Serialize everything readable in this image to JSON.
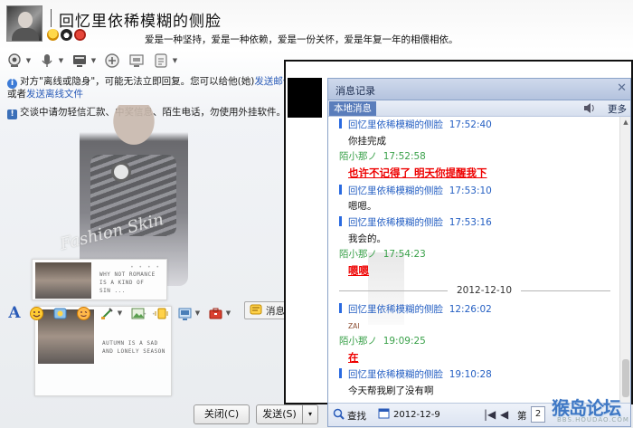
{
  "header": {
    "contact_name": "回忆里依稀模糊的侧脸",
    "signature": "爱是一种坚持，爱是一种依赖，爱是一份关怀，爱是年复一年的相偎相依。"
  },
  "tips": {
    "offline_prefix": "对方\"离线或隐身\"，可能无法立即回复。您可以给他(她)",
    "offline_link_1": "发送邮件",
    "offline_mid": "或者",
    "offline_link_2": "发送离线文件",
    "safety": "交谈中请勿轻信汇款、中奖信息、陌生电话，勿使用外挂软件。"
  },
  "skin": {
    "fashion_text": "Fashion Skin",
    "card_1_caption": "WHY NOT ROMANCE\nIS A KIND OF\nSIN ...",
    "card_2_caption": "AUTUMN IS A SAD\nAND LONELY SEASON"
  },
  "format_toolbar": {
    "font_glyph": "A",
    "chat_log_label": "消息记录"
  },
  "buttons": {
    "close": "关闭(C)",
    "send": "发送(S)",
    "send_options": "▾"
  },
  "history": {
    "title": "消息记录",
    "close_glyph": "✕",
    "local_tab": "本地消息",
    "more": "更多",
    "date_divider": "2012-12-10",
    "messages": [
      {
        "sender": "回忆里依稀模糊的侧脸",
        "time": "17:52:40",
        "text": "你挂完成"
      },
      {
        "sender": "陌小那ノ",
        "time": "17:52:58",
        "text": "也许不记得了 明天你提醒我下"
      },
      {
        "sender": "回忆里依稀模糊的侧脸",
        "time": "17:53:10",
        "text": "嗯嗯。"
      },
      {
        "sender": "回忆里依稀模糊的侧脸",
        "time": "17:53:16",
        "text": "我会的。"
      },
      {
        "sender": "陌小那ノ",
        "time": "17:54:23",
        "text": "嗯嗯"
      },
      {
        "sender": "回忆里依稀模糊的侧脸",
        "time": "12:26:02",
        "text": "ZAI"
      },
      {
        "sender": "陌小那ノ",
        "time": "19:09:25",
        "text": "在"
      },
      {
        "sender": "回忆里依稀模糊的侧脸",
        "time": "19:10:28",
        "text": "今天帮我刷了没有啊"
      }
    ],
    "footer": {
      "find_label": "查找",
      "date_value": "2012-12-9",
      "first_glyph": "|◀",
      "prev_glyph": "◀",
      "page_label": "第",
      "page_value": "2"
    }
  },
  "watermark": {
    "title": "猴岛论坛",
    "subtitle": "BBS.HOUDAO.COM"
  },
  "colors": {
    "self_name": "#2660c3",
    "other_name": "#3aa14a",
    "alert_text": "#e00000",
    "panel_border": "#8aa2c8"
  },
  "icons": [
    "video-call-icon",
    "voice-call-icon",
    "screen-share-icon",
    "add-member-icon",
    "remote-assist-icon",
    "app-icon",
    "emoji-icon",
    "face-magic-icon",
    "wink-icon",
    "screenshot-icon",
    "image-icon",
    "shake-icon",
    "music-icon",
    "toolbox-icon",
    "chat-log-icon",
    "speaker-icon",
    "find-icon",
    "calendar-icon"
  ]
}
